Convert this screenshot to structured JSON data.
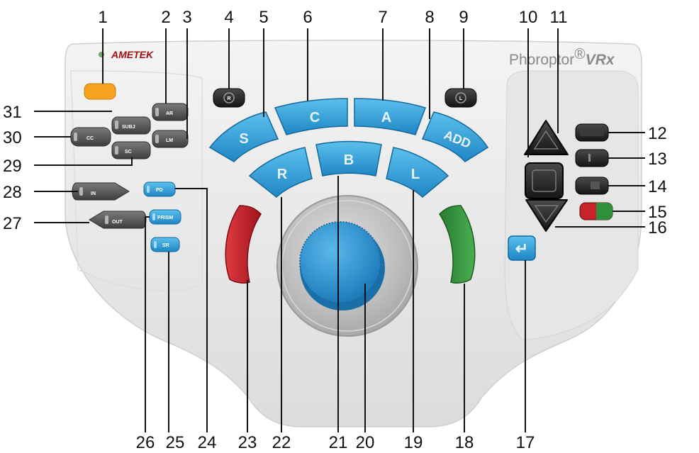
{
  "brand": "AMETEK",
  "product_name": "Phoroptor",
  "product_suffix": "VRx",
  "registered_mark": "®",
  "buttons": {
    "S": "S",
    "C": "C",
    "A": "A",
    "ADD": "ADD",
    "R": "R",
    "B": "B",
    "L": "L",
    "IN": "IN",
    "OUT": "OUT",
    "CC": "CC",
    "SC": "SC",
    "AR": "AR",
    "LM": "LM",
    "SUBJ": "SUBJ",
    "PD": "PD",
    "PRISM": "PRISM",
    "SR": "SR",
    "R_small": "R",
    "L_small": "L",
    "enter": "↵"
  },
  "callouts": [
    "1",
    "2",
    "3",
    "4",
    "5",
    "6",
    "7",
    "8",
    "9",
    "10",
    "11",
    "12",
    "13",
    "14",
    "15",
    "16",
    "17",
    "18",
    "19",
    "20",
    "21",
    "22",
    "23",
    "24",
    "25",
    "26",
    "27",
    "28",
    "29",
    "30",
    "31"
  ],
  "colors": {
    "body": "#ebebeb",
    "blue_button": "#2f9fd8",
    "gray_button": "#5a5a5a",
    "orange_button": "#f5a01a",
    "red_button": "#c8222a",
    "green_button": "#2f8f3a",
    "knob": "#2f9ad6"
  }
}
